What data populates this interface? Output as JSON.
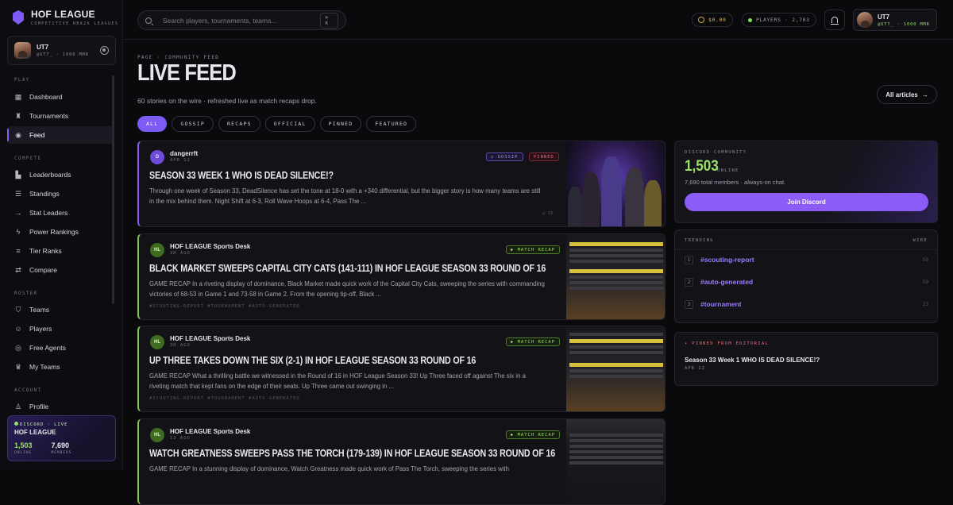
{
  "brand": {
    "title": "HOF LEAGUE",
    "subtitle": "COMPETITIVE NBA2K LEAGUES"
  },
  "user": {
    "name": "UT7",
    "meta": "@UT7_ · 1000 MMR"
  },
  "nav": {
    "play_label": "PLAY",
    "compete_label": "COMPETE",
    "roster_label": "ROSTER",
    "account_label": "ACCOUNT",
    "play": [
      {
        "label": "Dashboard",
        "icon": "grid-icon"
      },
      {
        "label": "Tournaments",
        "icon": "trophy-icon"
      },
      {
        "label": "Feed",
        "icon": "signal-icon",
        "active": true
      }
    ],
    "compete": [
      {
        "label": "Leaderboards",
        "icon": "bar-chart-icon"
      },
      {
        "label": "Standings",
        "icon": "standings-icon"
      },
      {
        "label": "Stat Leaders",
        "icon": "arrow-right-icon"
      },
      {
        "label": "Power Rankings",
        "icon": "lightning-icon"
      },
      {
        "label": "Tier Ranks",
        "icon": "layers-icon"
      },
      {
        "label": "Compare",
        "icon": "swap-icon"
      }
    ],
    "roster": [
      {
        "label": "Teams",
        "icon": "shield-icon"
      },
      {
        "label": "Players",
        "icon": "users-icon"
      },
      {
        "label": "Free Agents",
        "icon": "target-icon"
      },
      {
        "label": "My Teams",
        "icon": "crown-icon"
      }
    ],
    "account": [
      {
        "label": "Profile",
        "icon": "user-icon"
      }
    ]
  },
  "discord_box": {
    "label": "DISCORD · LIVE",
    "name": "HOF LEAGUE",
    "online": "1,503",
    "online_label": "ONLINE",
    "members": "7,690",
    "members_label": "MEMBERS"
  },
  "header": {
    "search_placeholder": "Search players, tournaments, teams...",
    "shortcut": "⌘ K",
    "balance": "$0.00",
    "players": "PLAYERS · 2,703",
    "user_name": "UT7",
    "user_meta": "@UT7_ · 1000 MMR"
  },
  "page": {
    "crumb": "PAGE · COMMUNITY FEED",
    "title": "LIVE FEED",
    "subtitle": "60 stories on the wire · refreshed live as match recaps drop.",
    "all_articles": "All articles"
  },
  "filters": [
    "ALL",
    "GOSSIP",
    "RECAPS",
    "OFFICIAL",
    "PINNED",
    "FEATURED"
  ],
  "posts": [
    {
      "author": "dangerrft",
      "initial": "D",
      "date": "APR 12",
      "title": "SEASON 33 WEEK 1 WHO IS DEAD SILENCE!?",
      "body": "Through one week of Season 33, DeadSilence has set the tone at 18-0 with a +340 differential, but the bigger story is how many teams are still in the mix behind them. Night Shift at 6-3, Roll Wave Hoops at 6-4, Pass The ...",
      "badge1": "⌂ GOSSIP",
      "badge2": "PINNED",
      "views": "◎ 19",
      "tags": ""
    },
    {
      "author": "HOF LEAGUE Sports Desk",
      "initial": "HL",
      "date": "3H AGO",
      "title": "BLACK MARKET SWEEPS CAPITAL CITY CATS (141-111) IN HOF LEAGUE SEASON 33 ROUND OF 16",
      "body": "GAME RECAP In a riveting display of dominance, Black Market made quick work of the Capital City Cats, sweeping the series with commanding victories of 68-53 in Game 1 and 73-58 in Game 2. From the opening tip-off, Black ...",
      "badge1": "▶ MATCH RECAP",
      "tags": "#SCOUTING-REPORT  #TOURNAMENT  #AUTO-GENERATED"
    },
    {
      "author": "HOF LEAGUE Sports Desk",
      "initial": "HL",
      "date": "3H AGO",
      "title": "UP THREE TAKES DOWN THE SIX (2-1) IN HOF LEAGUE SEASON 33 ROUND OF 16",
      "body": "GAME RECAP What a thrilling battle we witnessed in the Round of 16 in HOF League Season 33! Up Three faced off against The six in a riveting match that kept fans on the edge of their seats. Up Three came out swinging in ...",
      "badge1": "▶ MATCH RECAP",
      "tags": "#SCOUTING-REPORT  #TOURNAMENT  #AUTO-GENERATED"
    },
    {
      "author": "HOF LEAGUE Sports Desk",
      "initial": "HL",
      "date": "13 AGO",
      "title": "WATCH GREATNESS SWEEPS PASS THE TORCH (179-139) IN HOF LEAGUE SEASON 33 ROUND OF 16",
      "body": "GAME RECAP In a stunning display of dominance, Watch Greatness made quick work of Pass The Torch, sweeping the series with",
      "badge1": "▶ MATCH RECAP",
      "tags": ""
    }
  ],
  "community": {
    "label": "DISCORD COMMUNITY",
    "online": "1,503",
    "online_label": "ONLINE",
    "total": "7,690 total members · always-on chat.",
    "join": "Join Discord"
  },
  "trending": {
    "label": "TRENDING",
    "right_label": "WIRE",
    "items": [
      {
        "n": "1",
        "tag": "#scouting-report",
        "count": "59"
      },
      {
        "n": "2",
        "tag": "#auto-generated",
        "count": "59"
      },
      {
        "n": "3",
        "tag": "#tournament",
        "count": "23"
      }
    ]
  },
  "pinned": {
    "label": "• PINNED FROM EDITORIAL",
    "title": "Season 33 Week 1 WHO IS DEAD SILENCE!?",
    "date": "APR 12"
  },
  "colors": {
    "accent": "#8b5cf6",
    "green": "#9ae06a",
    "pinned": "#f06a7c"
  }
}
